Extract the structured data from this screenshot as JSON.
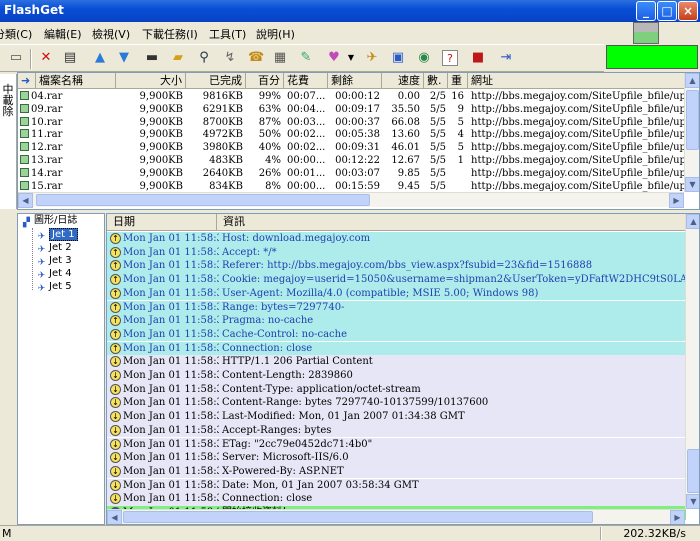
{
  "window": {
    "title": "FlashGet"
  },
  "menu": [
    "分類(C)",
    "編輯(E)",
    "檢視(V)",
    "下載任務(I)",
    "工具(T)",
    "說明(H)"
  ],
  "toolbar_icons": [
    "new-download-icon",
    "delete-icon",
    "properties-icon",
    "move-up-icon",
    "move-down-icon",
    "start-icon",
    "open-folder-icon",
    "find-icon",
    "connect-icon",
    "dial-icon",
    "schedule-icon",
    "edit-icon",
    "skin-icon",
    "dropdown-arrow-icon",
    "jet-icon",
    "monitor-icon",
    "globe-icon",
    "help-icon",
    "site-explorer-icon",
    "exit-icon"
  ],
  "category_strip": [
    "中",
    "載",
    "除"
  ],
  "downloads": {
    "columns": [
      "",
      "檔案名稱",
      "大小",
      "已完成",
      "百分",
      "花費",
      "剩餘",
      "速度",
      "數.",
      "重",
      "網址"
    ],
    "rows": [
      {
        "name": "04.rar",
        "size": "9,900KB",
        "done": "9816KB",
        "pct": "99%",
        "spent": "00:07...",
        "left": "00:00:12",
        "speed": "0.00",
        "blocks": "2/5",
        "retry": "16",
        "url": "http://bbs.megajoy.com/SiteUpfile_bfile/up_file/2"
      },
      {
        "name": "09.rar",
        "size": "9,900KB",
        "done": "6291KB",
        "pct": "63%",
        "spent": "00:04...",
        "left": "00:09:17",
        "speed": "35.50",
        "blocks": "5/5",
        "retry": "9",
        "url": "http://bbs.megajoy.com/SiteUpfile_bfile/up_file/2"
      },
      {
        "name": "10.rar",
        "size": "9,900KB",
        "done": "8700KB",
        "pct": "87%",
        "spent": "00:03...",
        "left": "00:00:37",
        "speed": "66.08",
        "blocks": "5/5",
        "retry": "5",
        "url": "http://bbs.megajoy.com/SiteUpfile_bfile/up_file/2"
      },
      {
        "name": "11.rar",
        "size": "9,900KB",
        "done": "4972KB",
        "pct": "50%",
        "spent": "00:02...",
        "left": "00:05:38",
        "speed": "13.60",
        "blocks": "5/5",
        "retry": "4",
        "url": "http://bbs.megajoy.com/SiteUpfile_bfile/up_file/2"
      },
      {
        "name": "12.rar",
        "size": "9,900KB",
        "done": "3980KB",
        "pct": "40%",
        "spent": "00:02...",
        "left": "00:09:31",
        "speed": "46.01",
        "blocks": "5/5",
        "retry": "5",
        "url": "http://bbs.megajoy.com/SiteUpfile_bfile/up_file/2"
      },
      {
        "name": "13.rar",
        "size": "9,900KB",
        "done": "483KB",
        "pct": "4%",
        "spent": "00:00...",
        "left": "00:12:22",
        "speed": "12.67",
        "blocks": "5/5",
        "retry": "1",
        "url": "http://bbs.megajoy.com/SiteUpfile_bfile/up_file/2"
      },
      {
        "name": "14.rar",
        "size": "9,900KB",
        "done": "2640KB",
        "pct": "26%",
        "spent": "00:01...",
        "left": "00:03:07",
        "speed": "9.85",
        "blocks": "5/5",
        "retry": "",
        "url": "http://bbs.megajoy.com/SiteUpfile_bfile/up_file/2"
      },
      {
        "name": "15.rar",
        "size": "9,900KB",
        "done": "834KB",
        "pct": "8%",
        "spent": "00:00...",
        "left": "00:15:59",
        "speed": "9.45",
        "blocks": "5/5",
        "retry": "",
        "url": "http://bbs.megajoy.com/SiteUpfile_bfile/up_file/2"
      }
    ]
  },
  "tree": {
    "root": "圖形/日誌",
    "items": [
      "Jet 1",
      "Jet 2",
      "Jet 3",
      "Jet 4",
      "Jet 5"
    ],
    "selected": "Jet 1"
  },
  "log": {
    "columns": [
      "日期",
      "資訊"
    ],
    "rows": [
      {
        "kind": "req",
        "date": "Mon Jan 01 11:58:3...",
        "msg": "Host: download.megajoy.com"
      },
      {
        "kind": "req",
        "date": "Mon Jan 01 11:58:3...",
        "msg": "Accept: */*"
      },
      {
        "kind": "req",
        "date": "Mon Jan 01 11:58:3...",
        "msg": "Referer: http://bbs.megajoy.com/bbs_view.aspx?fsubid=23&fid=1516888"
      },
      {
        "kind": "req",
        "date": "Mon Jan 01 11:58:3...",
        "msg": "Cookie: megajoy=userid=15050&username=shipman2&UserToken=yDFaftW2DHC9tS0LAghcE30KJ2y4X14"
      },
      {
        "kind": "req",
        "date": "Mon Jan 01 11:58:3...",
        "msg": "User-Agent: Mozilla/4.0 (compatible; MSIE 5.00; Windows 98)"
      },
      {
        "kind": "req",
        "date": "Mon Jan 01 11:58:3...",
        "msg": "Range: bytes=7297740-"
      },
      {
        "kind": "req",
        "date": "Mon Jan 01 11:58:3...",
        "msg": "Pragma: no-cache"
      },
      {
        "kind": "req",
        "date": "Mon Jan 01 11:58:3...",
        "msg": "Cache-Control: no-cache"
      },
      {
        "kind": "req",
        "date": "Mon Jan 01 11:58:3...",
        "msg": "Connection: close"
      },
      {
        "kind": "resp",
        "date": "Mon Jan 01 11:58:3...",
        "msg": "HTTP/1.1 206 Partial Content"
      },
      {
        "kind": "resp",
        "date": "Mon Jan 01 11:58:3...",
        "msg": "Content-Length: 2839860"
      },
      {
        "kind": "resp",
        "date": "Mon Jan 01 11:58:3...",
        "msg": "Content-Type: application/octet-stream"
      },
      {
        "kind": "resp",
        "date": "Mon Jan 01 11:58:3...",
        "msg": "Content-Range: bytes 7297740-10137599/10137600"
      },
      {
        "kind": "resp",
        "date": "Mon Jan 01 11:58:3...",
        "msg": "Last-Modified: Mon, 01 Jan 2007 01:34:38 GMT"
      },
      {
        "kind": "resp",
        "date": "Mon Jan 01 11:58:3...",
        "msg": "Accept-Ranges: bytes"
      },
      {
        "kind": "resp",
        "date": "Mon Jan 01 11:58:3...",
        "msg": "ETag: \"2cc79e0452dc71:4b0\""
      },
      {
        "kind": "resp",
        "date": "Mon Jan 01 11:58:3...",
        "msg": "Server: Microsoft-IIS/6.0"
      },
      {
        "kind": "resp",
        "date": "Mon Jan 01 11:58:3...",
        "msg": "X-Powered-By: ASP.NET"
      },
      {
        "kind": "resp",
        "date": "Mon Jan 01 11:58:3...",
        "msg": "Date: Mon, 01 Jan 2007 03:58:34 GMT"
      },
      {
        "kind": "resp",
        "date": "Mon Jan 01 11:58:3...",
        "msg": "Connection: close"
      },
      {
        "kind": "info",
        "date": "Mon Jan 01 11:58:3...",
        "msg": "開始接收資料！"
      }
    ]
  },
  "status": {
    "left": "M",
    "speed": "202.32KB/s"
  },
  "colors": {
    "request_row": "#aeecec",
    "response_row": "#e6e6f7",
    "info_row": "#7ef07e",
    "title_bar": "#0a4ed6",
    "status_indicator": "#00ff00"
  }
}
